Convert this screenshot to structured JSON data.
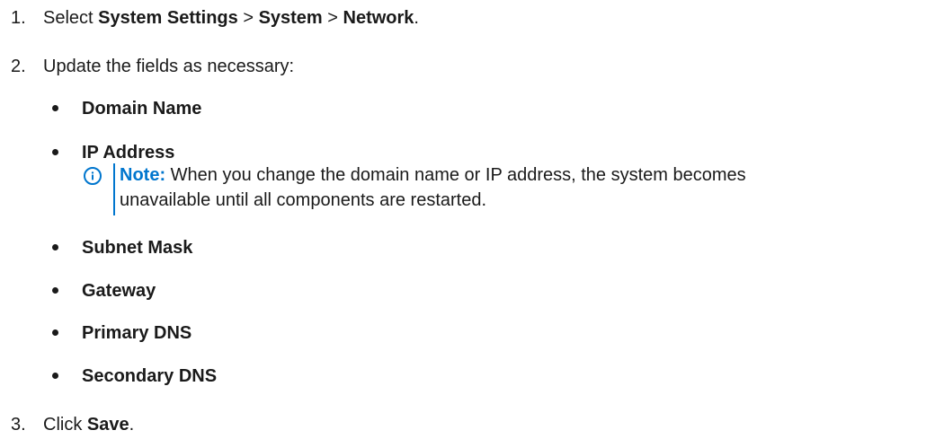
{
  "steps": [
    {
      "number": "1.",
      "prefix": "Select ",
      "path_1": "System Settings",
      "sep_1": " > ",
      "path_2": "System",
      "sep_2": " > ",
      "path_3": "Network",
      "suffix": "."
    },
    {
      "number": "2.",
      "text": "Update the fields as necessary:",
      "fields": [
        "Domain Name",
        "IP Address",
        "Subnet Mask",
        "Gateway",
        "Primary DNS",
        "Secondary DNS"
      ],
      "note": {
        "label": "Note:",
        "line_1": " When you change the domain name or IP address, the system becomes",
        "line_2": "unavailable until all components are restarted."
      }
    },
    {
      "number": "3.",
      "prefix": "Click ",
      "action": "Save",
      "suffix": "."
    }
  ],
  "colors": {
    "note_accent": "#0076ce"
  }
}
